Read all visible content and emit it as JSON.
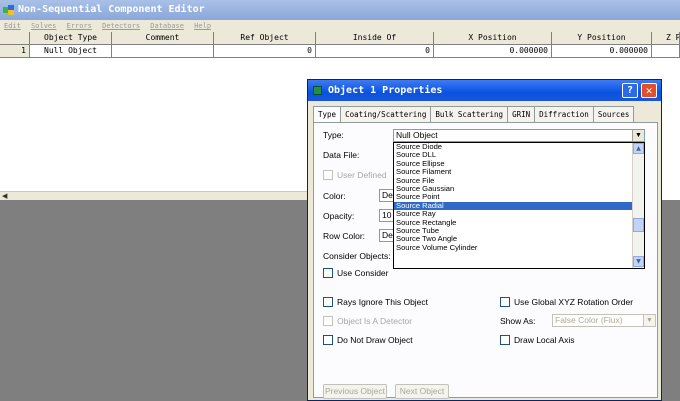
{
  "editor": {
    "title": "Non-Sequential Component Editor",
    "menu": [
      "Edit",
      "Solves",
      "Errors",
      "Detectors",
      "Database",
      "Help"
    ],
    "columns": [
      "",
      "Object Type",
      "Comment",
      "Ref Object",
      "Inside Of",
      "X Position",
      "Y Position",
      "Z P"
    ],
    "rows": [
      {
        "num": "1",
        "type": "Null Object",
        "comment": "",
        "ref": "0",
        "inside": "0",
        "x": "0.000000",
        "y": "0.000000",
        "z": ""
      }
    ]
  },
  "dialog": {
    "title": "Object 1 Properties",
    "help": "?",
    "close": "✕",
    "tabs": [
      "Type",
      "Coating/Scattering",
      "Bulk Scattering",
      "GRIN",
      "Diffraction",
      "Sources"
    ],
    "type_label": "Type:",
    "type_value": "Null Object",
    "data_file_label": "Data File:",
    "user_defined_label": "User Defined",
    "color_label": "Color:",
    "color_value": "De",
    "opacity_label": "Opacity:",
    "opacity_value": "10",
    "row_color_label": "Row Color:",
    "row_color_value": "De",
    "consider_objects_label": "Consider Objects:",
    "use_consider_label": "Use Consider",
    "options": [
      "Source Diode",
      "Source DLL",
      "Source Ellipse",
      "Source Filament",
      "Source File",
      "Source Gaussian",
      "Source Point",
      "Source Radial",
      "Source Ray",
      "Source Rectangle",
      "Source Tube",
      "Source Two Angle",
      "Source Volume Cylinder"
    ],
    "selected_option": "Source Radial",
    "rays_ignore_label": "Rays Ignore This Object",
    "use_global_label": "Use Global XYZ Rotation Order",
    "is_detector_label": "Object Is A Detector",
    "show_as_label": "Show As:",
    "show_as_value": "False Color (Flux)",
    "do_not_draw_label": "Do Not Draw Object",
    "draw_local_label": "Draw Local Axis",
    "prev_button": "Previous Object",
    "next_button": "Next Object"
  }
}
